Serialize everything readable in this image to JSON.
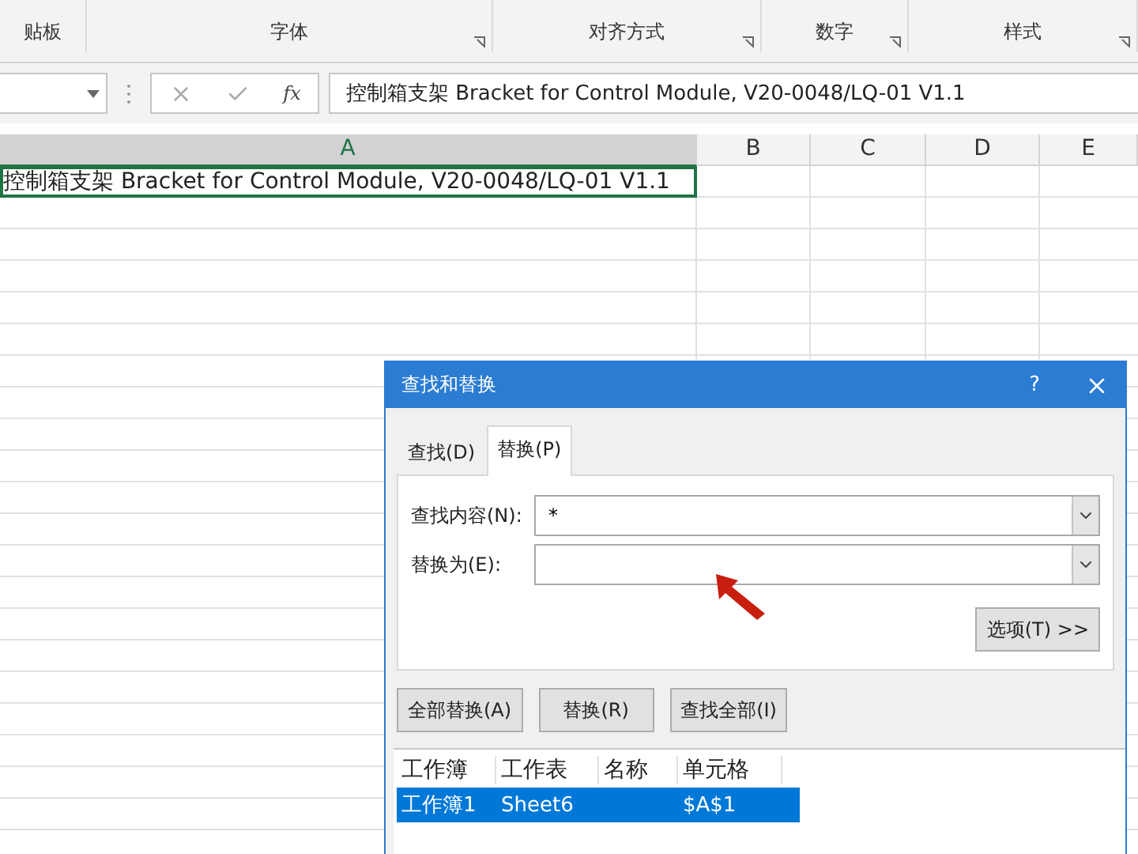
{
  "ribbon": {
    "groups": [
      {
        "label": "贴板"
      },
      {
        "label": "字体"
      },
      {
        "label": "对齐方式"
      },
      {
        "label": "数字"
      },
      {
        "label": "样式"
      }
    ]
  },
  "formula_bar": {
    "function_label": "fx",
    "formula": "控制箱支架 Bracket for Control Module, V20-0048/LQ-01 V1.1"
  },
  "sheet": {
    "columns": [
      {
        "label": "A",
        "selected": true
      },
      {
        "label": "B",
        "selected": false
      },
      {
        "label": "C",
        "selected": false
      },
      {
        "label": "D",
        "selected": false
      },
      {
        "label": "E",
        "selected": false
      }
    ],
    "rows": [
      {
        "text": "控制箱支架 Bracket for Control Module, V20-0048/LQ-01 V1.1",
        "selected": true
      }
    ]
  },
  "dialog": {
    "title": "查找和替换",
    "help": "?",
    "tabs": [
      {
        "label": "查找(D)",
        "selected": false
      },
      {
        "label": "替换(P)",
        "selected": true
      }
    ],
    "find_label": "查找内容(N):",
    "find_value": "*",
    "replace_label": "替换为(E):",
    "options_button": "选项(T) >>",
    "buttons": [
      "全部替换(A)",
      "替换(R)",
      "查找全部(I)"
    ],
    "results": {
      "columns": [
        "工作簿",
        "工作表",
        "名称",
        "单元格"
      ],
      "rows": [
        {
          "cells": [
            "工作簿1",
            "Sheet6",
            null,
            "$A$1"
          ],
          "selected": true
        }
      ]
    }
  }
}
